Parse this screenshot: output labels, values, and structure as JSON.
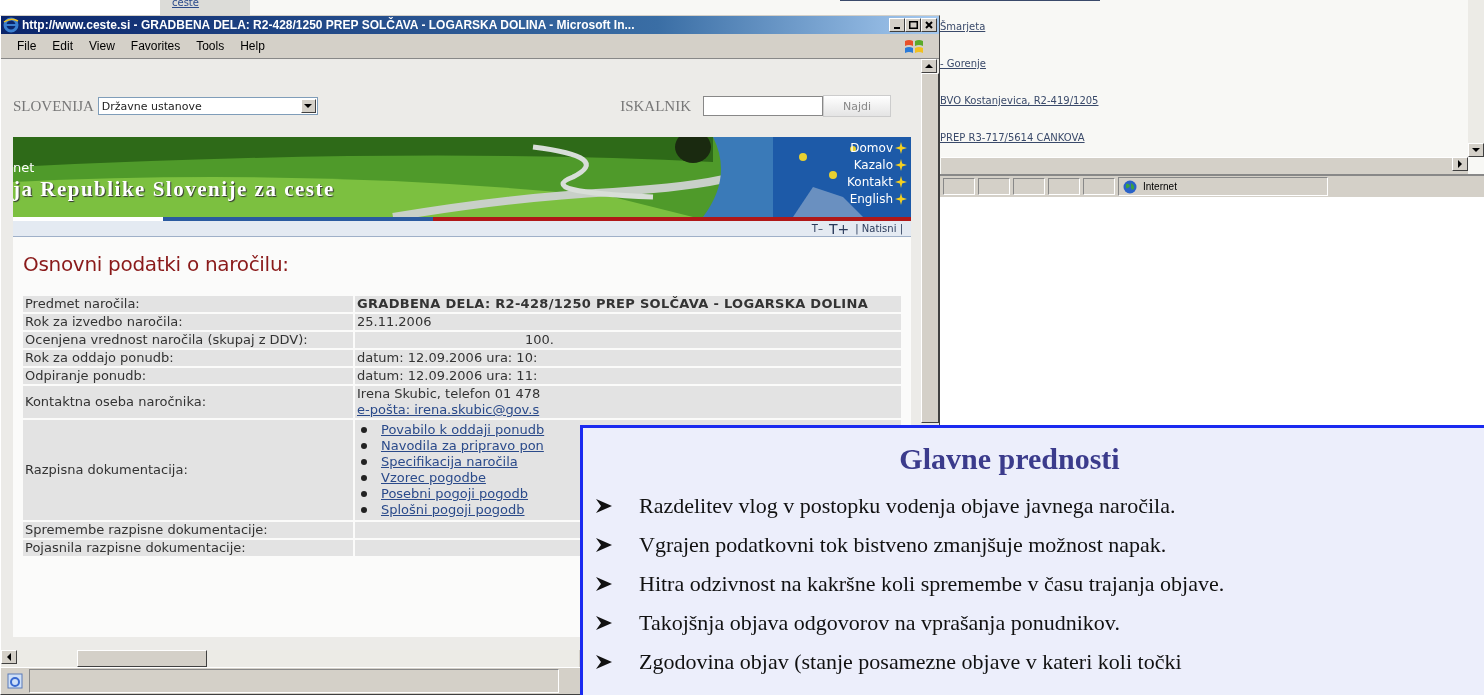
{
  "back_window": {
    "sidebar_item": "ceste",
    "links": [
      "Šmarjeta",
      "- Gorenje",
      "BVO Kostanjevica, R2-419/1205",
      "PREP R3-717/5614 CANKOVA"
    ],
    "status_zone": "Internet"
  },
  "window": {
    "title": "http://www.ceste.si - GRADBENA DELA: R2-428/1250 PREP SOLČAVA - LOGARSKA DOLINA - Microsoft In...",
    "menu": [
      {
        "label": "File"
      },
      {
        "label": "Edit"
      },
      {
        "label": "View"
      },
      {
        "label": "Favorites"
      },
      {
        "label": "Tools"
      },
      {
        "label": "Help"
      }
    ]
  },
  "page": {
    "country_label": "SLOVENIJA",
    "country_select": "Državne ustanove",
    "search_label": "ISKALNIK",
    "search_button": "Najdi",
    "banner": {
      "site_fragment": "net",
      "title": "ja Republike Slovenije za ceste",
      "nav": [
        "Domov",
        "Kazalo",
        "Kontakt",
        "English"
      ]
    },
    "tools": [
      {
        "label": "T–",
        "kind": "small"
      },
      {
        "label": "T+",
        "kind": "large"
      },
      {
        "label": "| Natisni |",
        "kind": "plain"
      }
    ],
    "heading": "Osnovni podatki o naročilu:",
    "rows": [
      {
        "label": "Predmet naročila:",
        "kind": "bold",
        "value": "GRADBENA DELA: R2-428/1250 PREP SOLČAVA - LOGARSKA DOLINA"
      },
      {
        "label": "Rok za izvedbo naročila:",
        "kind": "text",
        "value": "25.11.2006"
      },
      {
        "label": "Ocenjena vrednost naročila (skupaj z DDV):",
        "kind": "amount",
        "value": "100."
      },
      {
        "label": "Rok za oddajo ponudb:",
        "kind": "text",
        "value": "datum: 12.09.2006 ura: 10:"
      },
      {
        "label": "Odpiranje ponudb:",
        "kind": "text",
        "value": "datum: 12.09.2006 ura: 11:"
      },
      {
        "label": "Kontaktna oseba naročnika:",
        "kind": "contact",
        "value": "Irena Skubic, telefon 01 478",
        "link": "e-pošta: irena.skubic@gov.s"
      },
      {
        "label": "Razpisna dokumentacija:",
        "kind": "links",
        "links": [
          "Povabilo k oddaji ponudb",
          "Navodila za pripravo pon",
          "Specifikacija naročila",
          "Vzorec pogodbe",
          "Posebni pogoji pogodb",
          "Splošni pogoji pogodb"
        ]
      },
      {
        "label": "Spremembe razpisne dokumentacije:",
        "kind": "empty"
      },
      {
        "label": "Pojasnila razpisne dokumentacije:",
        "kind": "empty"
      }
    ]
  },
  "slide": {
    "title": "Glavne prednosti",
    "bullets": [
      "Razdelitev vlog v postopku vodenja objave javnega naročila.",
      "Vgrajen podatkovni tok bistveno zmanjšuje možnost napak.",
      "Hitra odzivnost na kakršne koli spremembe v času trajanja objave.",
      "Takojšnja objava odgovorov na vprašanja ponudnikov.",
      "Zgodovina objav (stanje posamezne objave v kateri koli točki"
    ]
  }
}
